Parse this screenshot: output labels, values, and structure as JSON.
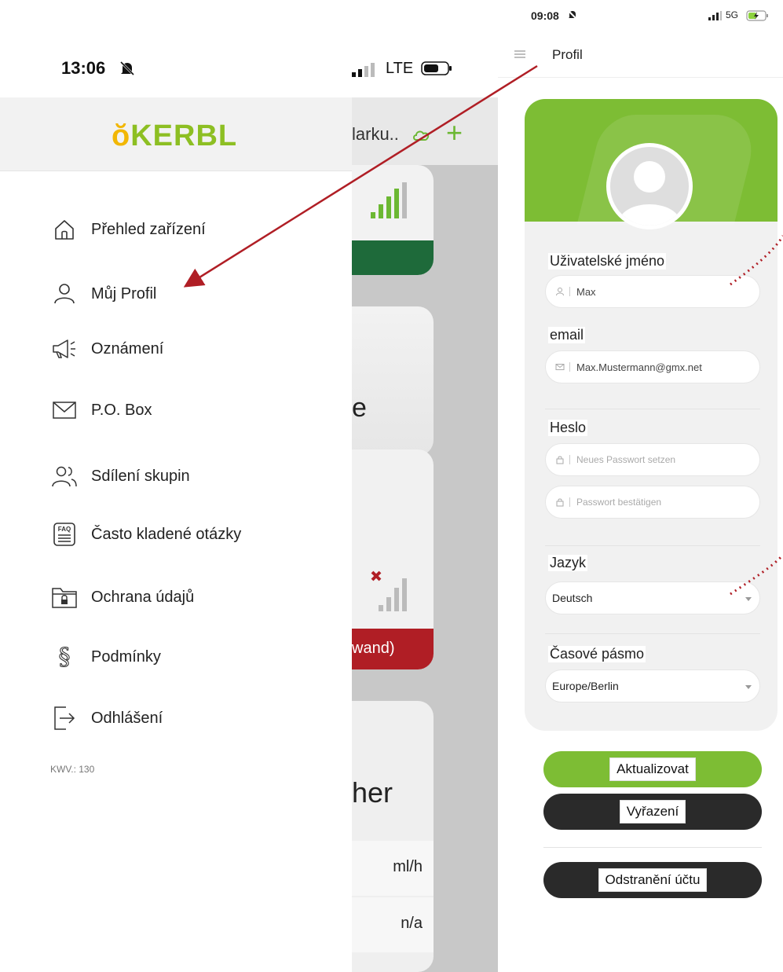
{
  "left": {
    "status": {
      "time": "13:06",
      "network": "LTE"
    },
    "background_app": {
      "header_text": "larku..",
      "card2_text": "e",
      "card3_bar_text": "wand)",
      "card4_text": "her",
      "rows": [
        "ml/h",
        "n/a"
      ]
    },
    "drawer": {
      "logo": "KERBL",
      "items": [
        {
          "label": "Přehled zařízení",
          "icon": "home-icon"
        },
        {
          "label": "Můj Profil",
          "icon": "user-icon"
        },
        {
          "label": "Oznámení",
          "icon": "megaphone-icon"
        },
        {
          "label": "P.O. Box",
          "icon": "mail-icon"
        },
        {
          "label": "Sdílení skupin",
          "icon": "group-icon"
        },
        {
          "label": "Často kladené otázky",
          "icon": "faq-icon"
        },
        {
          "label": "Ochrana údajů",
          "icon": "lock-folder-icon"
        },
        {
          "label": "Podmínky",
          "icon": "paragraph-icon"
        },
        {
          "label": "Odhlášení",
          "icon": "logout-icon"
        }
      ],
      "version": "KWV.: 130"
    }
  },
  "right": {
    "status": {
      "time": "09:08",
      "network": "5G"
    },
    "header": {
      "title": "Profil"
    },
    "form": {
      "username_label": "Uživatelské jméno",
      "username_value": "Max",
      "email_label": "email",
      "email_value": "Max.Mustermann@gmx.net",
      "password_label": "Heslo",
      "password_placeholder": "Neues Passwort setzen",
      "confirm_placeholder": "Passwort bestätigen",
      "language_label": "Jazyk",
      "language_value": "Deutsch",
      "timezone_label": "Časové pásmo",
      "timezone_value": "Europe/Berlin"
    },
    "buttons": {
      "update": "Aktualizovat",
      "discard": "Vyřazení",
      "delete_account": "Odstranění účtu"
    }
  },
  "colors": {
    "brand_green": "#7dbd34",
    "arrow_red": "#b01e25",
    "dark_button": "#2a2a2a",
    "alert_red": "#b01e25",
    "deep_green": "#1e6a3a"
  }
}
